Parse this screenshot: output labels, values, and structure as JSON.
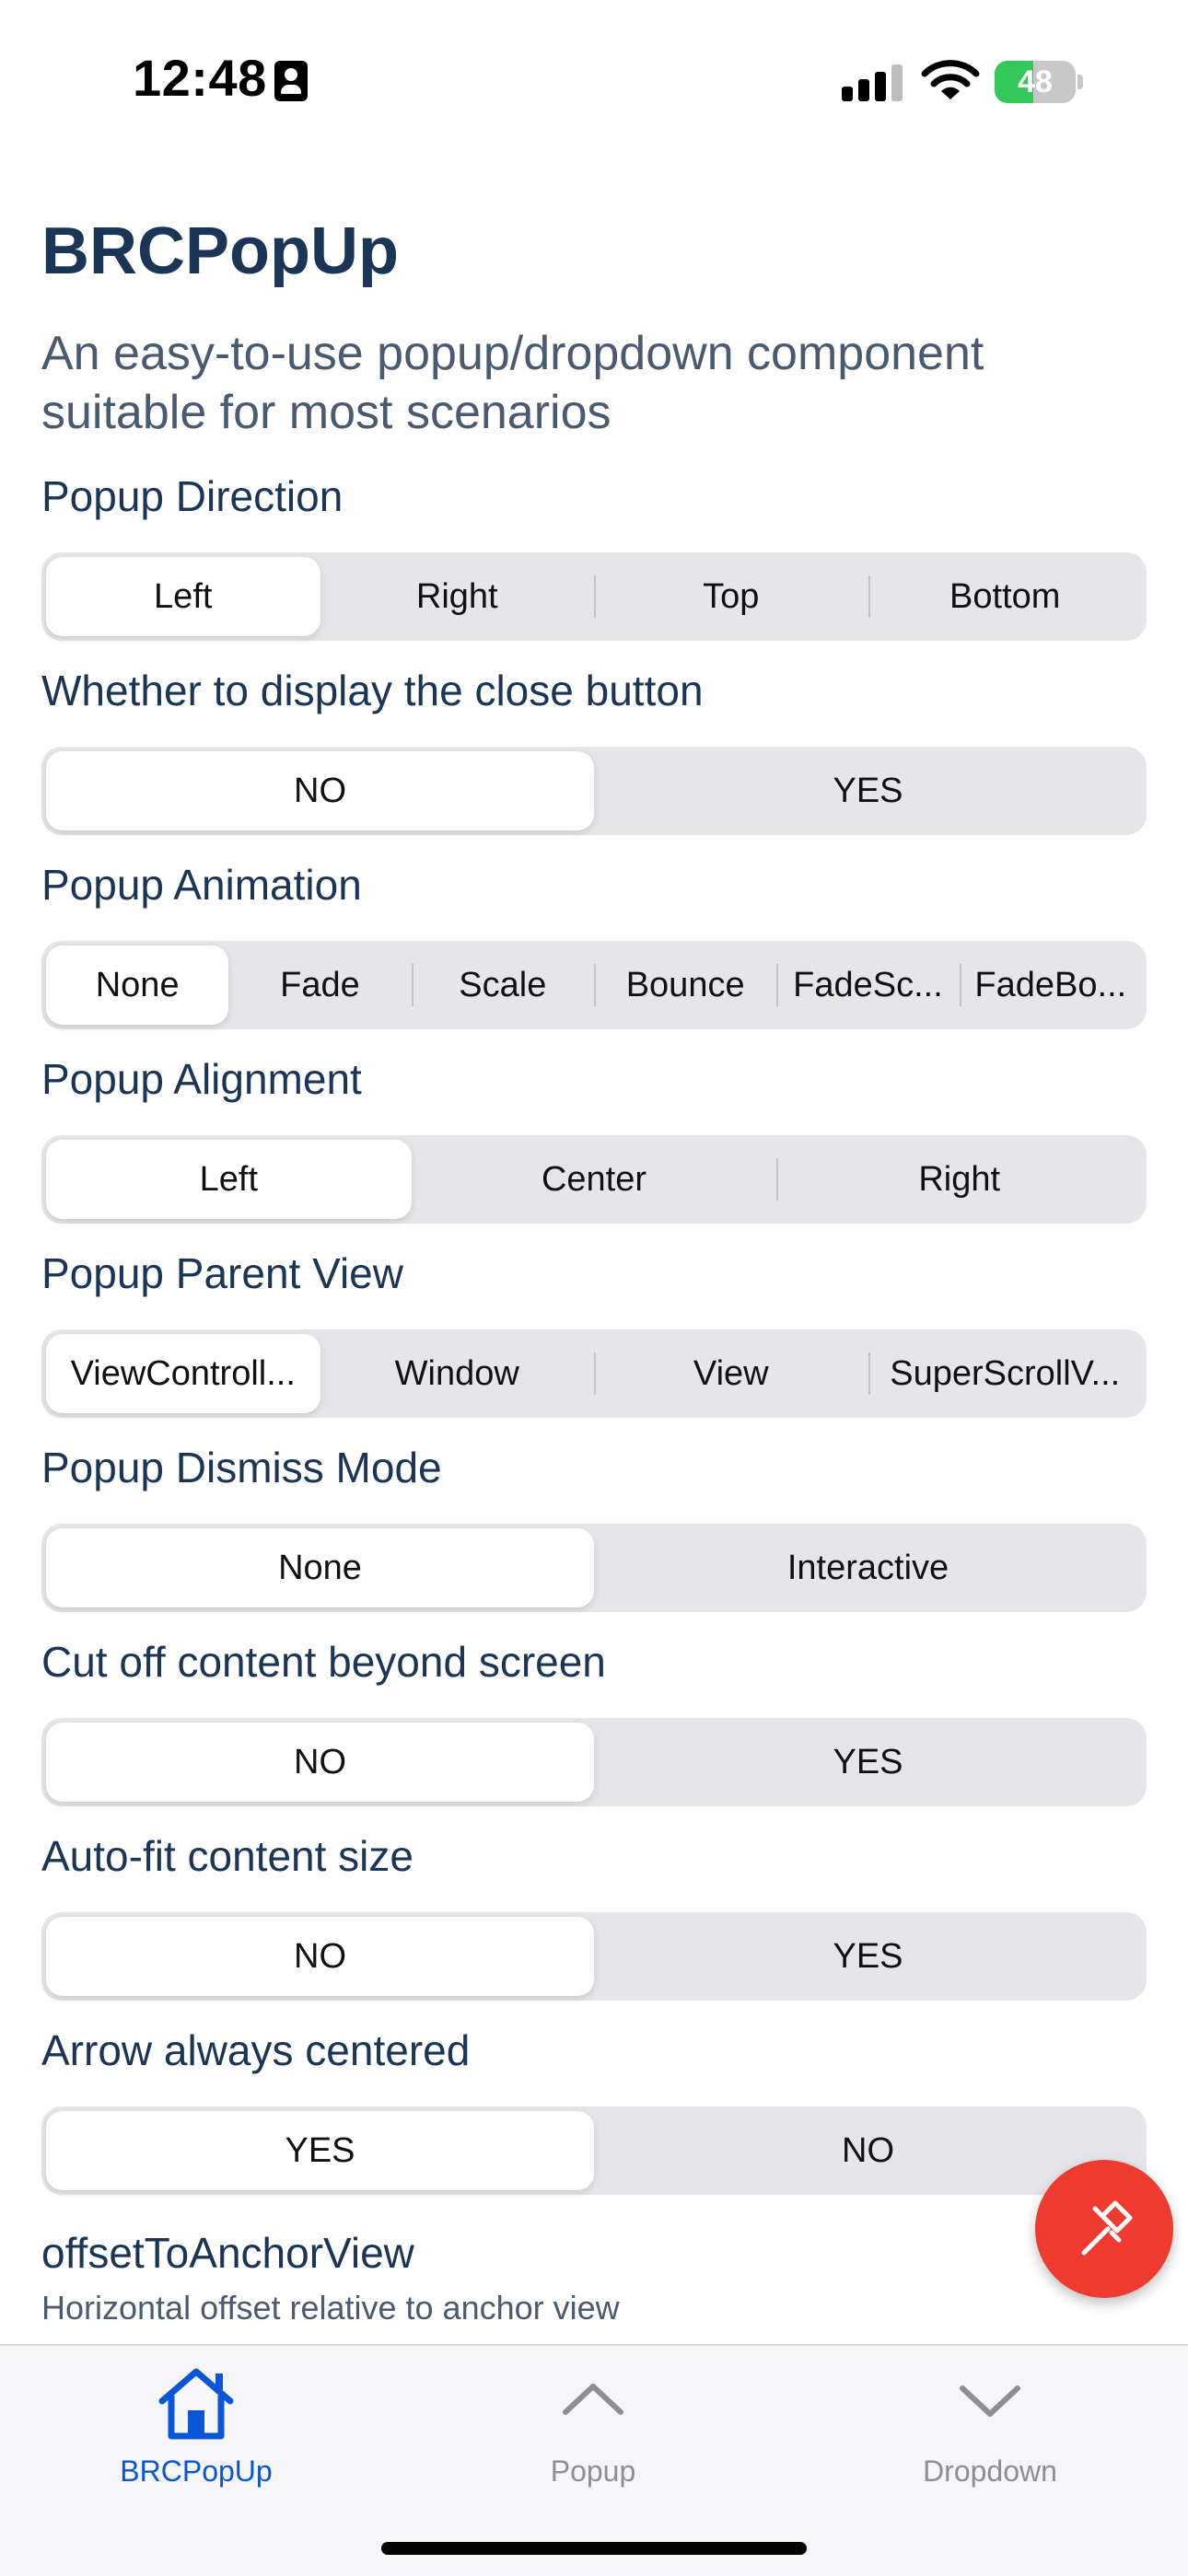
{
  "status_bar": {
    "time": "12:48",
    "battery": "48",
    "battery_level": 0.48
  },
  "header": {
    "title": "BRCPopUp",
    "subtitle": "An easy-to-use popup/dropdown component suitable for most scenarios"
  },
  "sections": [
    {
      "label": "Popup Direction",
      "options": [
        "Left",
        "Right",
        "Top",
        "Bottom"
      ],
      "selected": 0
    },
    {
      "label": "Whether to display the close button",
      "options": [
        "NO",
        "YES"
      ],
      "selected": 0
    },
    {
      "label": "Popup Animation",
      "options": [
        "None",
        "Fade",
        "Scale",
        "Bounce",
        "FadeSc...",
        "FadeBo..."
      ],
      "selected": 0
    },
    {
      "label": "Popup Alignment",
      "options": [
        "Left",
        "Center",
        "Right"
      ],
      "selected": 0
    },
    {
      "label": "Popup Parent View",
      "options": [
        "ViewControll...",
        "Window",
        "View",
        "SuperScrollV..."
      ],
      "selected": 0
    },
    {
      "label": "Popup Dismiss Mode",
      "options": [
        "None",
        "Interactive"
      ],
      "selected": 0
    },
    {
      "label": "Cut off content beyond screen",
      "options": [
        "NO",
        "YES"
      ],
      "selected": 0
    },
    {
      "label": "Auto-fit content size",
      "options": [
        "NO",
        "YES"
      ],
      "selected": 0
    },
    {
      "label": "Arrow always centered",
      "options": [
        "YES",
        "NO"
      ],
      "selected": 0
    }
  ],
  "offset": {
    "label": "offsetToAnchorView",
    "hint": "Horizontal offset relative to anchor view"
  },
  "fab": {
    "icon": "hammer-icon",
    "color": "#ee3a2f"
  },
  "tab_bar": {
    "tabs": [
      {
        "label": "BRCPopUp",
        "icon": "house-icon",
        "active": true
      },
      {
        "label": "Popup",
        "icon": "chevron-up-icon",
        "active": false
      },
      {
        "label": "Dropdown",
        "icon": "chevron-down-icon",
        "active": false
      }
    ],
    "active_color": "#0a56d8",
    "inactive_color": "#8e8e93"
  }
}
